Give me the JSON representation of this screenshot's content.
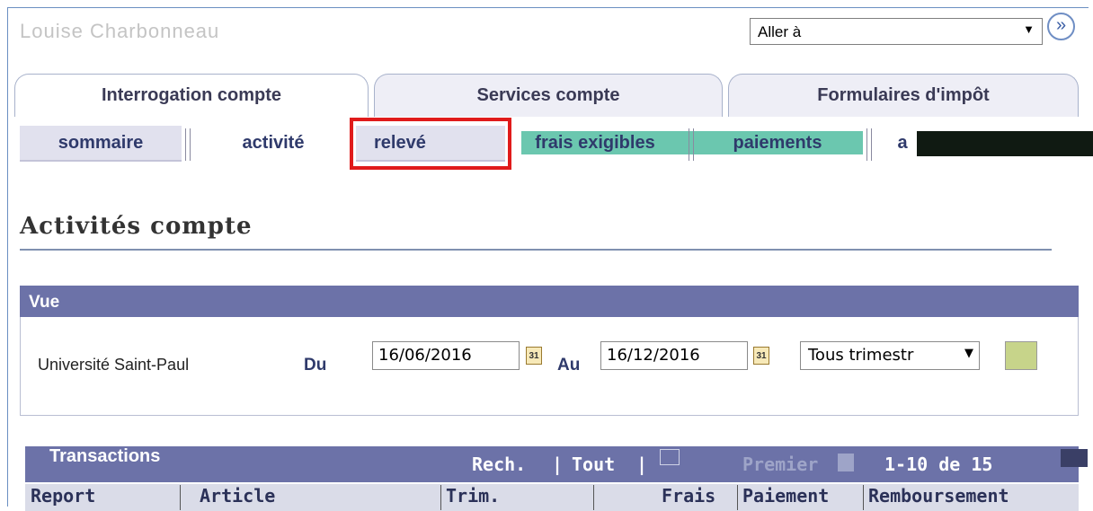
{
  "header": {
    "user_name": "Louise Charbonneau",
    "goto_select": "Aller à",
    "go_symbol": "»"
  },
  "tabs": [
    {
      "label": "Interrogation compte",
      "active": true
    },
    {
      "label": "Services compte",
      "active": false
    },
    {
      "label": "Formulaires d'impôt",
      "active": false
    }
  ],
  "subtabs": [
    {
      "label": "sommaire",
      "active": false
    },
    {
      "label": "activité",
      "active": true
    },
    {
      "label": "relevé",
      "active": false
    },
    {
      "label": "frais exigibles",
      "active": false
    },
    {
      "label": "paiements",
      "active": false
    },
    {
      "label": "a",
      "active": false
    }
  ],
  "page": {
    "title": "Activités compte"
  },
  "view": {
    "header": "Vue",
    "institution": "Université Saint-Paul",
    "from_label": "Du",
    "from_date": "16/06/2016",
    "to_label": "Au",
    "to_date": "16/12/2016",
    "term_select": "Tous trimestr",
    "calendar_glyph": "31"
  },
  "transactions": {
    "title": "Transactions",
    "search_link": "Rech.",
    "all_link": "Tout",
    "first_label": "Premier",
    "range": "1-10 de 15",
    "columns": [
      "Report",
      "Article",
      "Trim.",
      "Frais",
      "Paiement",
      "Remboursement"
    ]
  },
  "colors": {
    "accent": "#6c72a8",
    "highlight": "#e01b1b",
    "tab_text": "#3a3a55"
  }
}
